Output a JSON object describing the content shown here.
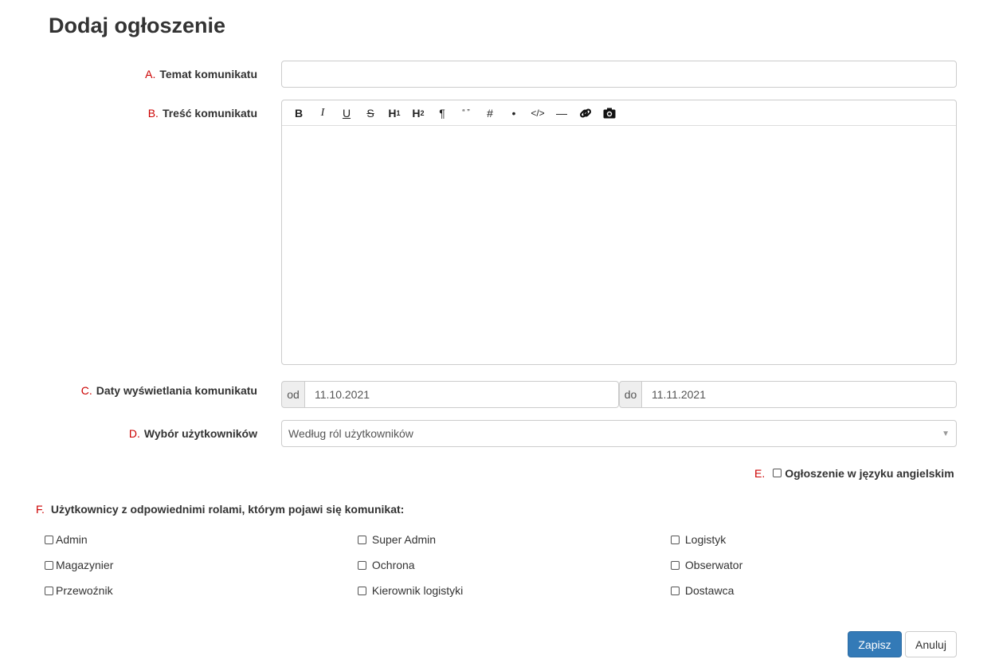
{
  "page": {
    "title": "Dodaj ogłoszenie"
  },
  "form": {
    "subject": {
      "letter": "A.",
      "label": "Temat komunikatu",
      "value": ""
    },
    "content": {
      "letter": "B.",
      "label": "Treść komunikatu",
      "value": "",
      "toolbar": [
        {
          "icon": "bold-icon",
          "glyph": "B"
        },
        {
          "icon": "italic-icon",
          "glyph": "I"
        },
        {
          "icon": "underline-icon",
          "glyph": "U"
        },
        {
          "icon": "strikethrough-icon",
          "glyph": "S"
        },
        {
          "icon": "heading1-icon",
          "glyph": "H1"
        },
        {
          "icon": "heading2-icon",
          "glyph": "H2"
        },
        {
          "icon": "paragraph-icon",
          "glyph": "¶"
        },
        {
          "icon": "quote-icon",
          "glyph": "“ ”"
        },
        {
          "icon": "numbered-list-icon",
          "glyph": "#"
        },
        {
          "icon": "bullet-list-icon",
          "glyph": "•"
        },
        {
          "icon": "code-icon",
          "glyph": "</>"
        },
        {
          "icon": "horizontal-rule-icon",
          "glyph": "—"
        },
        {
          "icon": "link-icon",
          "glyph": ""
        },
        {
          "icon": "image-icon",
          "glyph": ""
        }
      ]
    },
    "dates": {
      "letter": "C.",
      "label": "Daty wyświetlania komunikatu",
      "from_label": "od",
      "from_value": "11.10.2021",
      "to_label": "do",
      "to_value": "11.11.2021"
    },
    "users": {
      "letter": "D.",
      "label": "Wybór użytkowników",
      "selected": "Według ról użytkowników"
    },
    "english": {
      "letter": "E.",
      "label": "Ogłoszenie w języku angielskim",
      "checked": false
    },
    "roles": {
      "letter": "F.",
      "title": "Użytkownicy z odpowiednimi rolami, którym pojawi się komunikat:",
      "items": [
        {
          "label": "Admin",
          "checked": false
        },
        {
          "label": "Super Admin",
          "checked": false
        },
        {
          "label": "Logistyk",
          "checked": false
        },
        {
          "label": "Magazynier",
          "checked": false
        },
        {
          "label": "Ochrona",
          "checked": false
        },
        {
          "label": "Obserwator",
          "checked": false
        },
        {
          "label": "Przewoźnik",
          "checked": false
        },
        {
          "label": "Kierownik logistyki",
          "checked": false
        },
        {
          "label": "Dostawca",
          "checked": false
        }
      ]
    }
  },
  "actions": {
    "save": "Zapisz",
    "cancel": "Anuluj"
  },
  "colors": {
    "primary": "#337ab7",
    "letter": "#cc0000"
  }
}
